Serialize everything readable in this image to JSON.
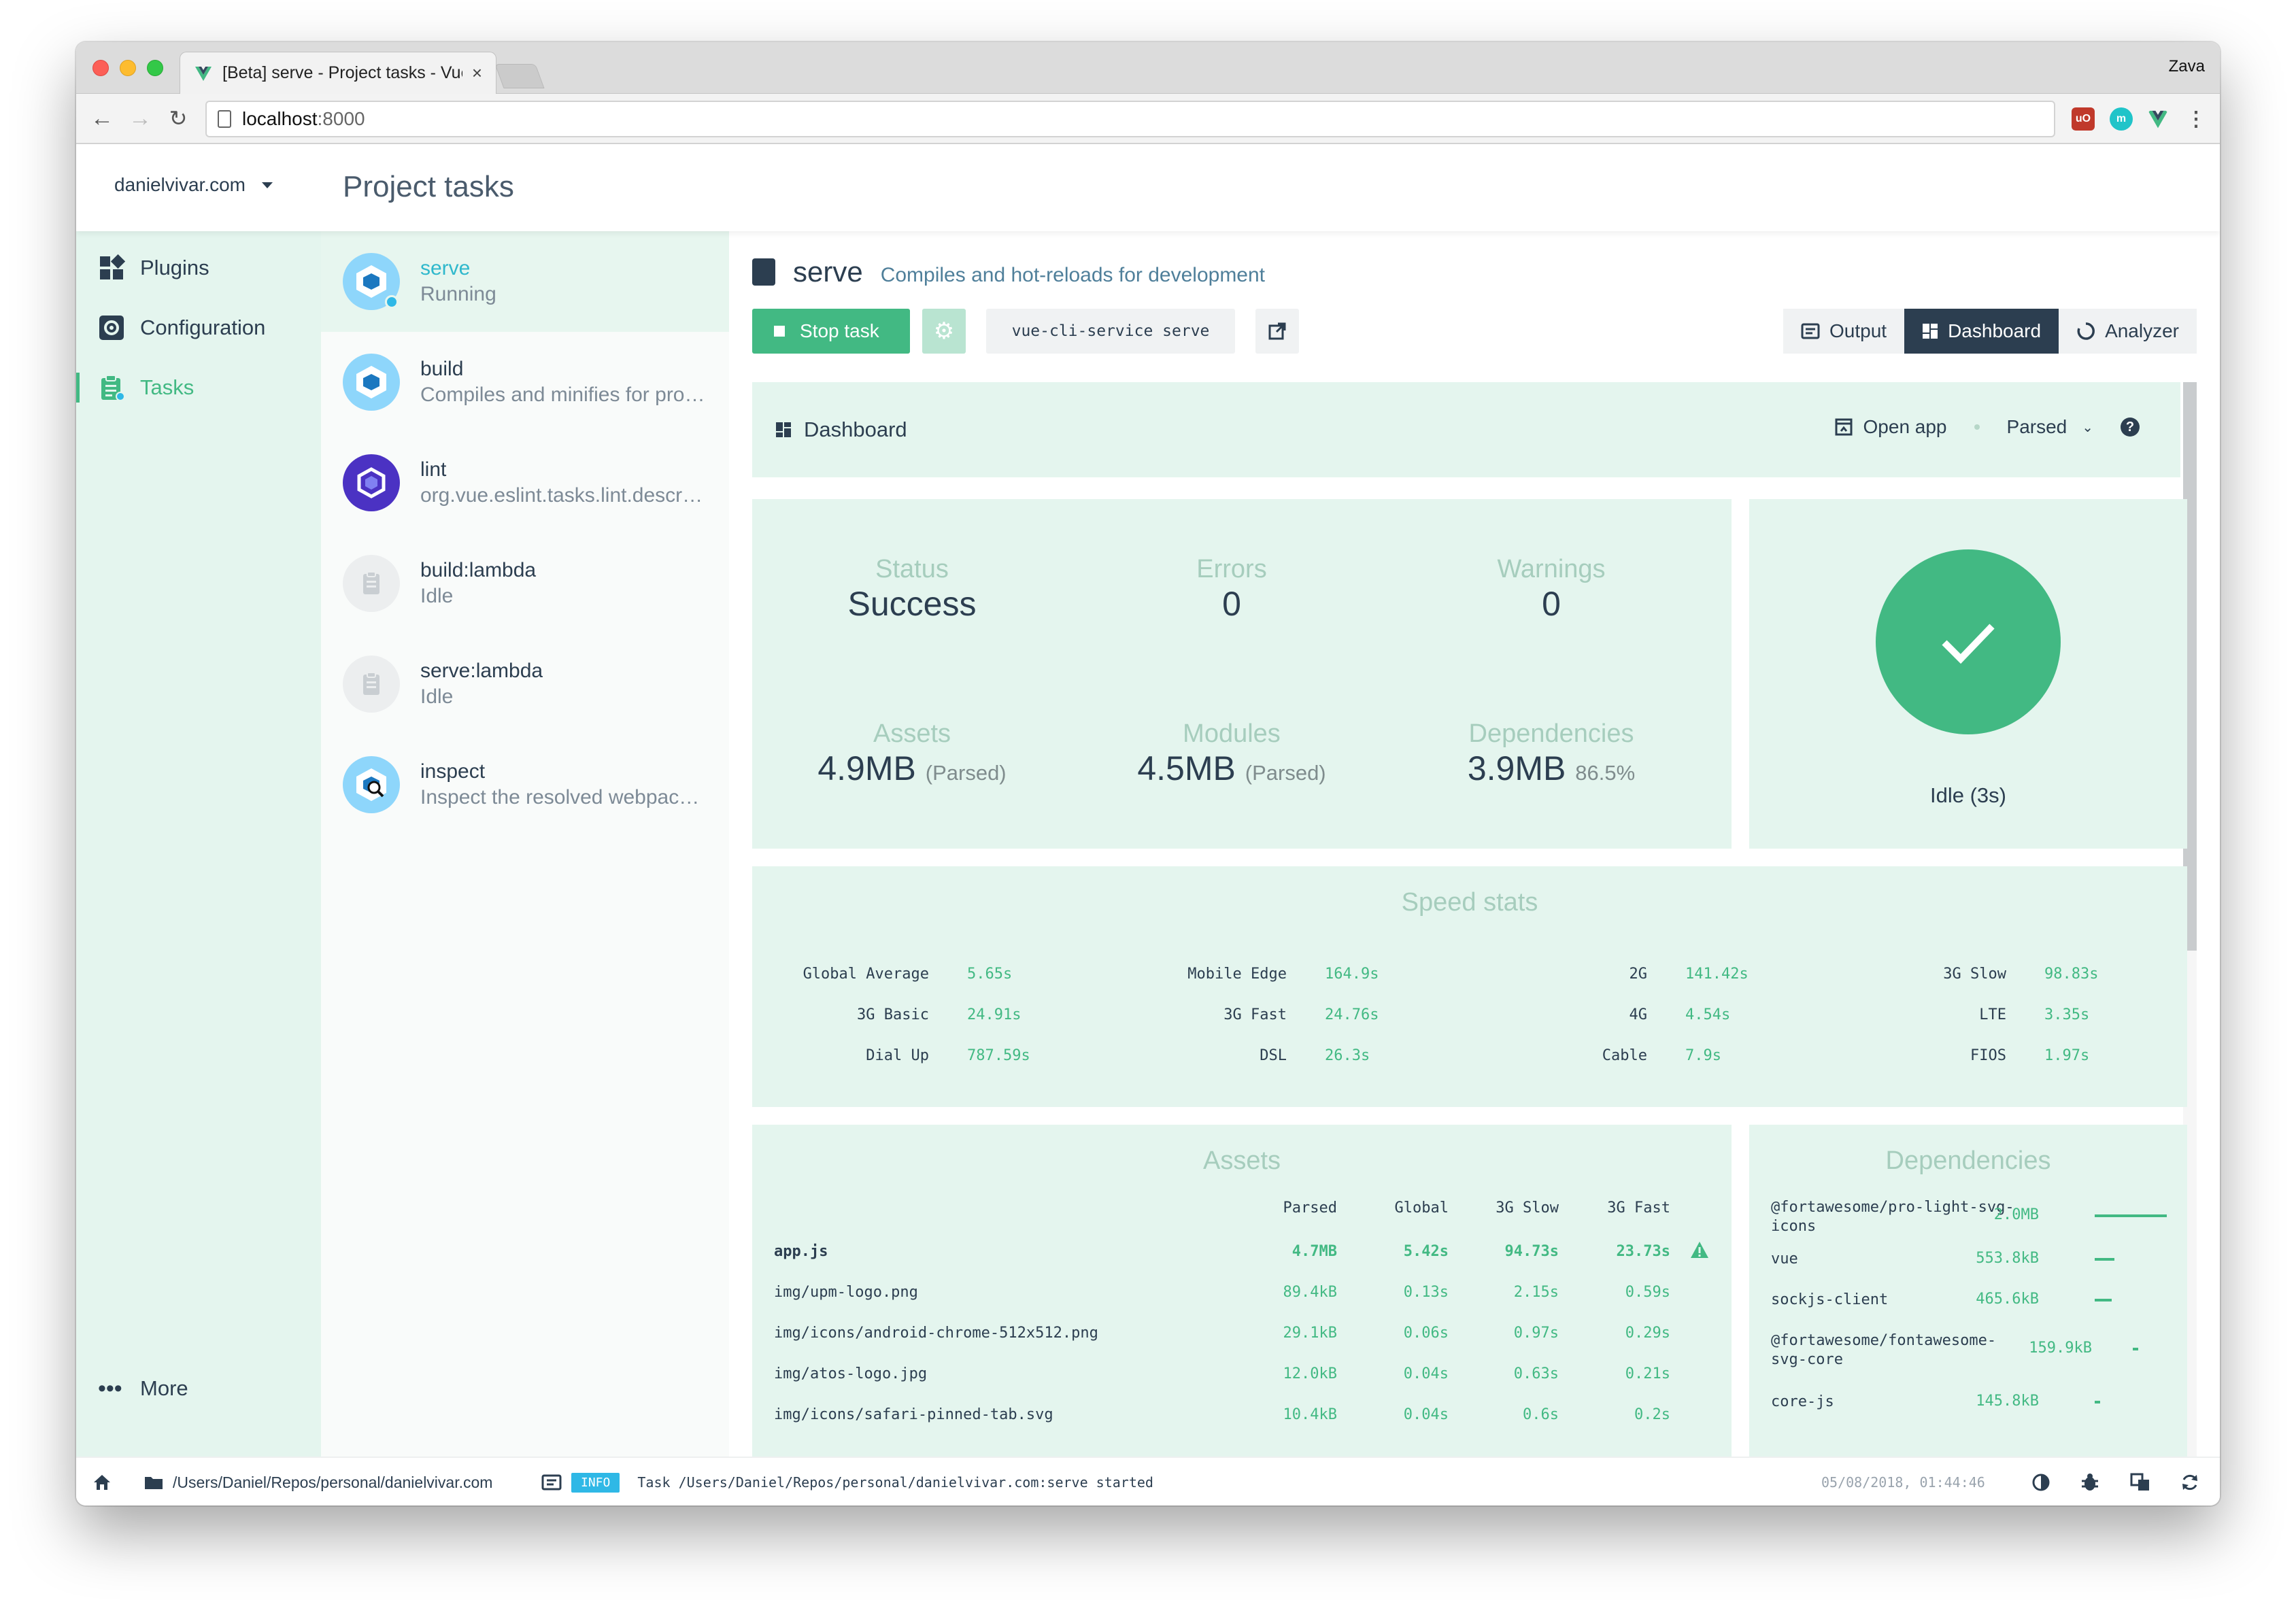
{
  "browser": {
    "tab_title": "[Beta] serve - Project tasks - Vue CLI",
    "profile_name": "Zava",
    "url_host": "localhost",
    "url_port": ":8000",
    "tab_close": "×"
  },
  "app": {
    "project_name": "danielvivar.com",
    "page_title": "Project tasks",
    "accent_color": "#42b983",
    "dark_color": "#2c3e50"
  },
  "nav": {
    "items": [
      {
        "label": "Plugins",
        "icon": "puzzle-icon"
      },
      {
        "label": "Configuration",
        "icon": "settings-icon"
      },
      {
        "label": "Tasks",
        "icon": "clipboard-icon"
      }
    ],
    "more_label": "More"
  },
  "tasks": [
    {
      "name": "serve",
      "desc": "Running",
      "icon": "webpack-icon"
    },
    {
      "name": "build",
      "desc": "Compiles and minifies for production",
      "icon": "webpack-icon"
    },
    {
      "name": "lint",
      "desc": "org.vue.eslint.tasks.lint.description",
      "icon": "eslint-icon"
    },
    {
      "name": "build:lambda",
      "desc": "Idle",
      "icon": "clipboard-icon"
    },
    {
      "name": "serve:lambda",
      "desc": "Idle",
      "icon": "clipboard-icon"
    },
    {
      "name": "inspect",
      "desc": "Inspect the resolved webpack config",
      "icon": "webpack-inspect-icon"
    }
  ],
  "task_detail": {
    "name": "serve",
    "description": "Compiles and hot-reloads for development",
    "stop_label": "Stop task",
    "command": "vue-cli-service serve",
    "views": [
      "Output",
      "Dashboard",
      "Analyzer"
    ]
  },
  "dashboard": {
    "title": "Dashboard",
    "open_app": "Open app",
    "size_mode": "Parsed",
    "help": "?",
    "stats": {
      "status_label": "Status",
      "status_value": "Success",
      "errors_label": "Errors",
      "errors_value": "0",
      "warnings_label": "Warnings",
      "warnings_value": "0",
      "assets_label": "Assets",
      "assets_value": "4.9MB",
      "assets_sub": "(Parsed)",
      "modules_label": "Modules",
      "modules_value": "4.5MB",
      "modules_sub": "(Parsed)",
      "deps_label": "Dependencies",
      "deps_value": "3.9MB",
      "deps_sub": "86.5%"
    },
    "idle_label": "Idle (3s)",
    "speed_title": "Speed stats",
    "speed": [
      {
        "label": "Global Average",
        "value": "5.65s"
      },
      {
        "label": "Mobile Edge",
        "value": "164.9s"
      },
      {
        "label": "2G",
        "value": "141.42s"
      },
      {
        "label": "3G Slow",
        "value": "98.83s"
      },
      {
        "label": "3G Basic",
        "value": "24.91s"
      },
      {
        "label": "3G Fast",
        "value": "24.76s"
      },
      {
        "label": "4G",
        "value": "4.54s"
      },
      {
        "label": "LTE",
        "value": "3.35s"
      },
      {
        "label": "Dial Up",
        "value": "787.59s"
      },
      {
        "label": "DSL",
        "value": "26.3s"
      },
      {
        "label": "Cable",
        "value": "7.9s"
      },
      {
        "label": "FIOS",
        "value": "1.97s"
      }
    ],
    "assets_title": "Assets",
    "assets_columns": [
      "Parsed",
      "Global",
      "3G Slow",
      "3G Fast"
    ],
    "assets": [
      {
        "name": "app.js",
        "parsed": "4.7MB",
        "global": "5.42s",
        "slow": "94.73s",
        "fast": "23.73s",
        "warning": true
      },
      {
        "name": "img/upm-logo.png",
        "parsed": "89.4kB",
        "global": "0.13s",
        "slow": "2.15s",
        "fast": "0.59s"
      },
      {
        "name": "img/icons/android-chrome-512x512.png",
        "parsed": "29.1kB",
        "global": "0.06s",
        "slow": "0.97s",
        "fast": "0.29s"
      },
      {
        "name": "img/atos-logo.jpg",
        "parsed": "12.0kB",
        "global": "0.04s",
        "slow": "0.63s",
        "fast": "0.21s"
      },
      {
        "name": "img/icons/safari-pinned-tab.svg",
        "parsed": "10.4kB",
        "global": "0.04s",
        "slow": "0.6s",
        "fast": "0.2s"
      }
    ],
    "deps_title": "Dependencies",
    "dependencies": [
      {
        "name": "@fortawesome/pro-light-svg-icons",
        "size": "2.0MB",
        "share": 1.0
      },
      {
        "name": "vue",
        "size": "553.8kB",
        "share": 0.277
      },
      {
        "name": "sockjs-client",
        "size": "465.6kB",
        "share": 0.233
      },
      {
        "name": "@fortawesome/fontawesome-svg-core",
        "size": "159.9kB",
        "share": 0.08
      },
      {
        "name": "core-js",
        "size": "145.8kB",
        "share": 0.073
      }
    ]
  },
  "statusbar": {
    "path": "/Users/Daniel/Repos/personal/danielvivar.com",
    "level": "INFO",
    "log": "Task /Users/Daniel/Repos/personal/danielvivar.com:serve started",
    "time": "05/08/2018, 01:44:46"
  }
}
